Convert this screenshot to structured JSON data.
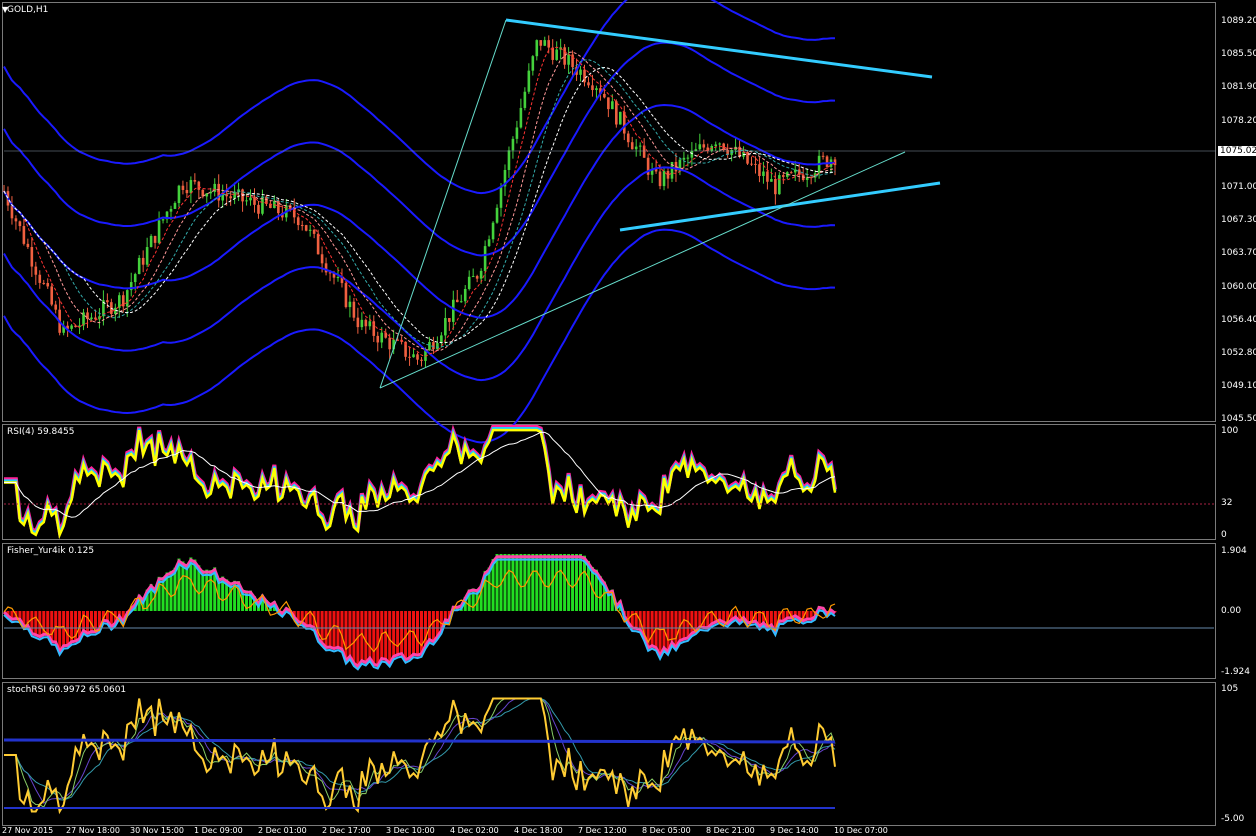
{
  "main": {
    "title": "GOLD,H1",
    "price_labels": [
      "1089.20",
      "1085.50",
      "1081.90",
      "1078.20",
      "1074.60",
      "1071.00",
      "1067.30",
      "1063.70",
      "1060.00",
      "1056.40",
      "1052.80",
      "1049.10",
      "1045.50"
    ],
    "current_price": "1075.02"
  },
  "rsi": {
    "title": "RSI(4) 59.8455",
    "labels": [
      "100",
      "32",
      "0"
    ]
  },
  "fisher": {
    "title": "Fisher_Yur4ik 0.125",
    "labels": [
      "1.904",
      "0.00",
      "-1.924"
    ]
  },
  "stoch": {
    "title": "stochRSI 60.9972 65.0601",
    "labels": [
      "105",
      "-5.00"
    ]
  },
  "time_labels": [
    "27 Nov 2015",
    "27 Nov 18:00",
    "30 Nov 15:00",
    "1 Dec 09:00",
    "2 Dec 01:00",
    "2 Dec 17:00",
    "3 Dec 10:00",
    "4 Dec 02:00",
    "4 Dec 18:00",
    "7 Dec 12:00",
    "8 Dec 05:00",
    "8 Dec 21:00",
    "9 Dec 14:00",
    "10 Dec 07:00"
  ],
  "chart_data": {
    "type": "line",
    "symbol": "GOLD",
    "timeframe": "H1",
    "ylim": [
      1045.5,
      1092.0
    ],
    "x": [
      "27 Nov 2015",
      "27 Nov 18:00",
      "30 Nov 15:00",
      "1 Dec 09:00",
      "2 Dec 01:00",
      "2 Dec 17:00",
      "3 Dec 10:00",
      "4 Dec 02:00",
      "4 Dec 18:00",
      "7 Dec 12:00",
      "8 Dec 05:00",
      "8 Dec 21:00",
      "9 Dec 14:00",
      "10 Dec 07:00"
    ],
    "series": [
      {
        "values": [
          1071.0,
          1055.0,
          1059.0,
          1072.0,
          1070.0,
          1068.0,
          1056.0,
          1052.0,
          1062.0,
          1088.0,
          1083.0,
          1072.0,
          1077.0,
          1071.5,
          1075.0
        ]
      }
    ],
    "current": 1075.02,
    "colors": {
      "bull": "#44d13c",
      "bear": "#f06040",
      "bands": "#1a1aff",
      "trend": "#33ccff",
      "rsi": "#ffff00",
      "hist_up": "#22dd22",
      "hist_dn": "#ee1111",
      "stoch": "#ffcc33"
    }
  }
}
